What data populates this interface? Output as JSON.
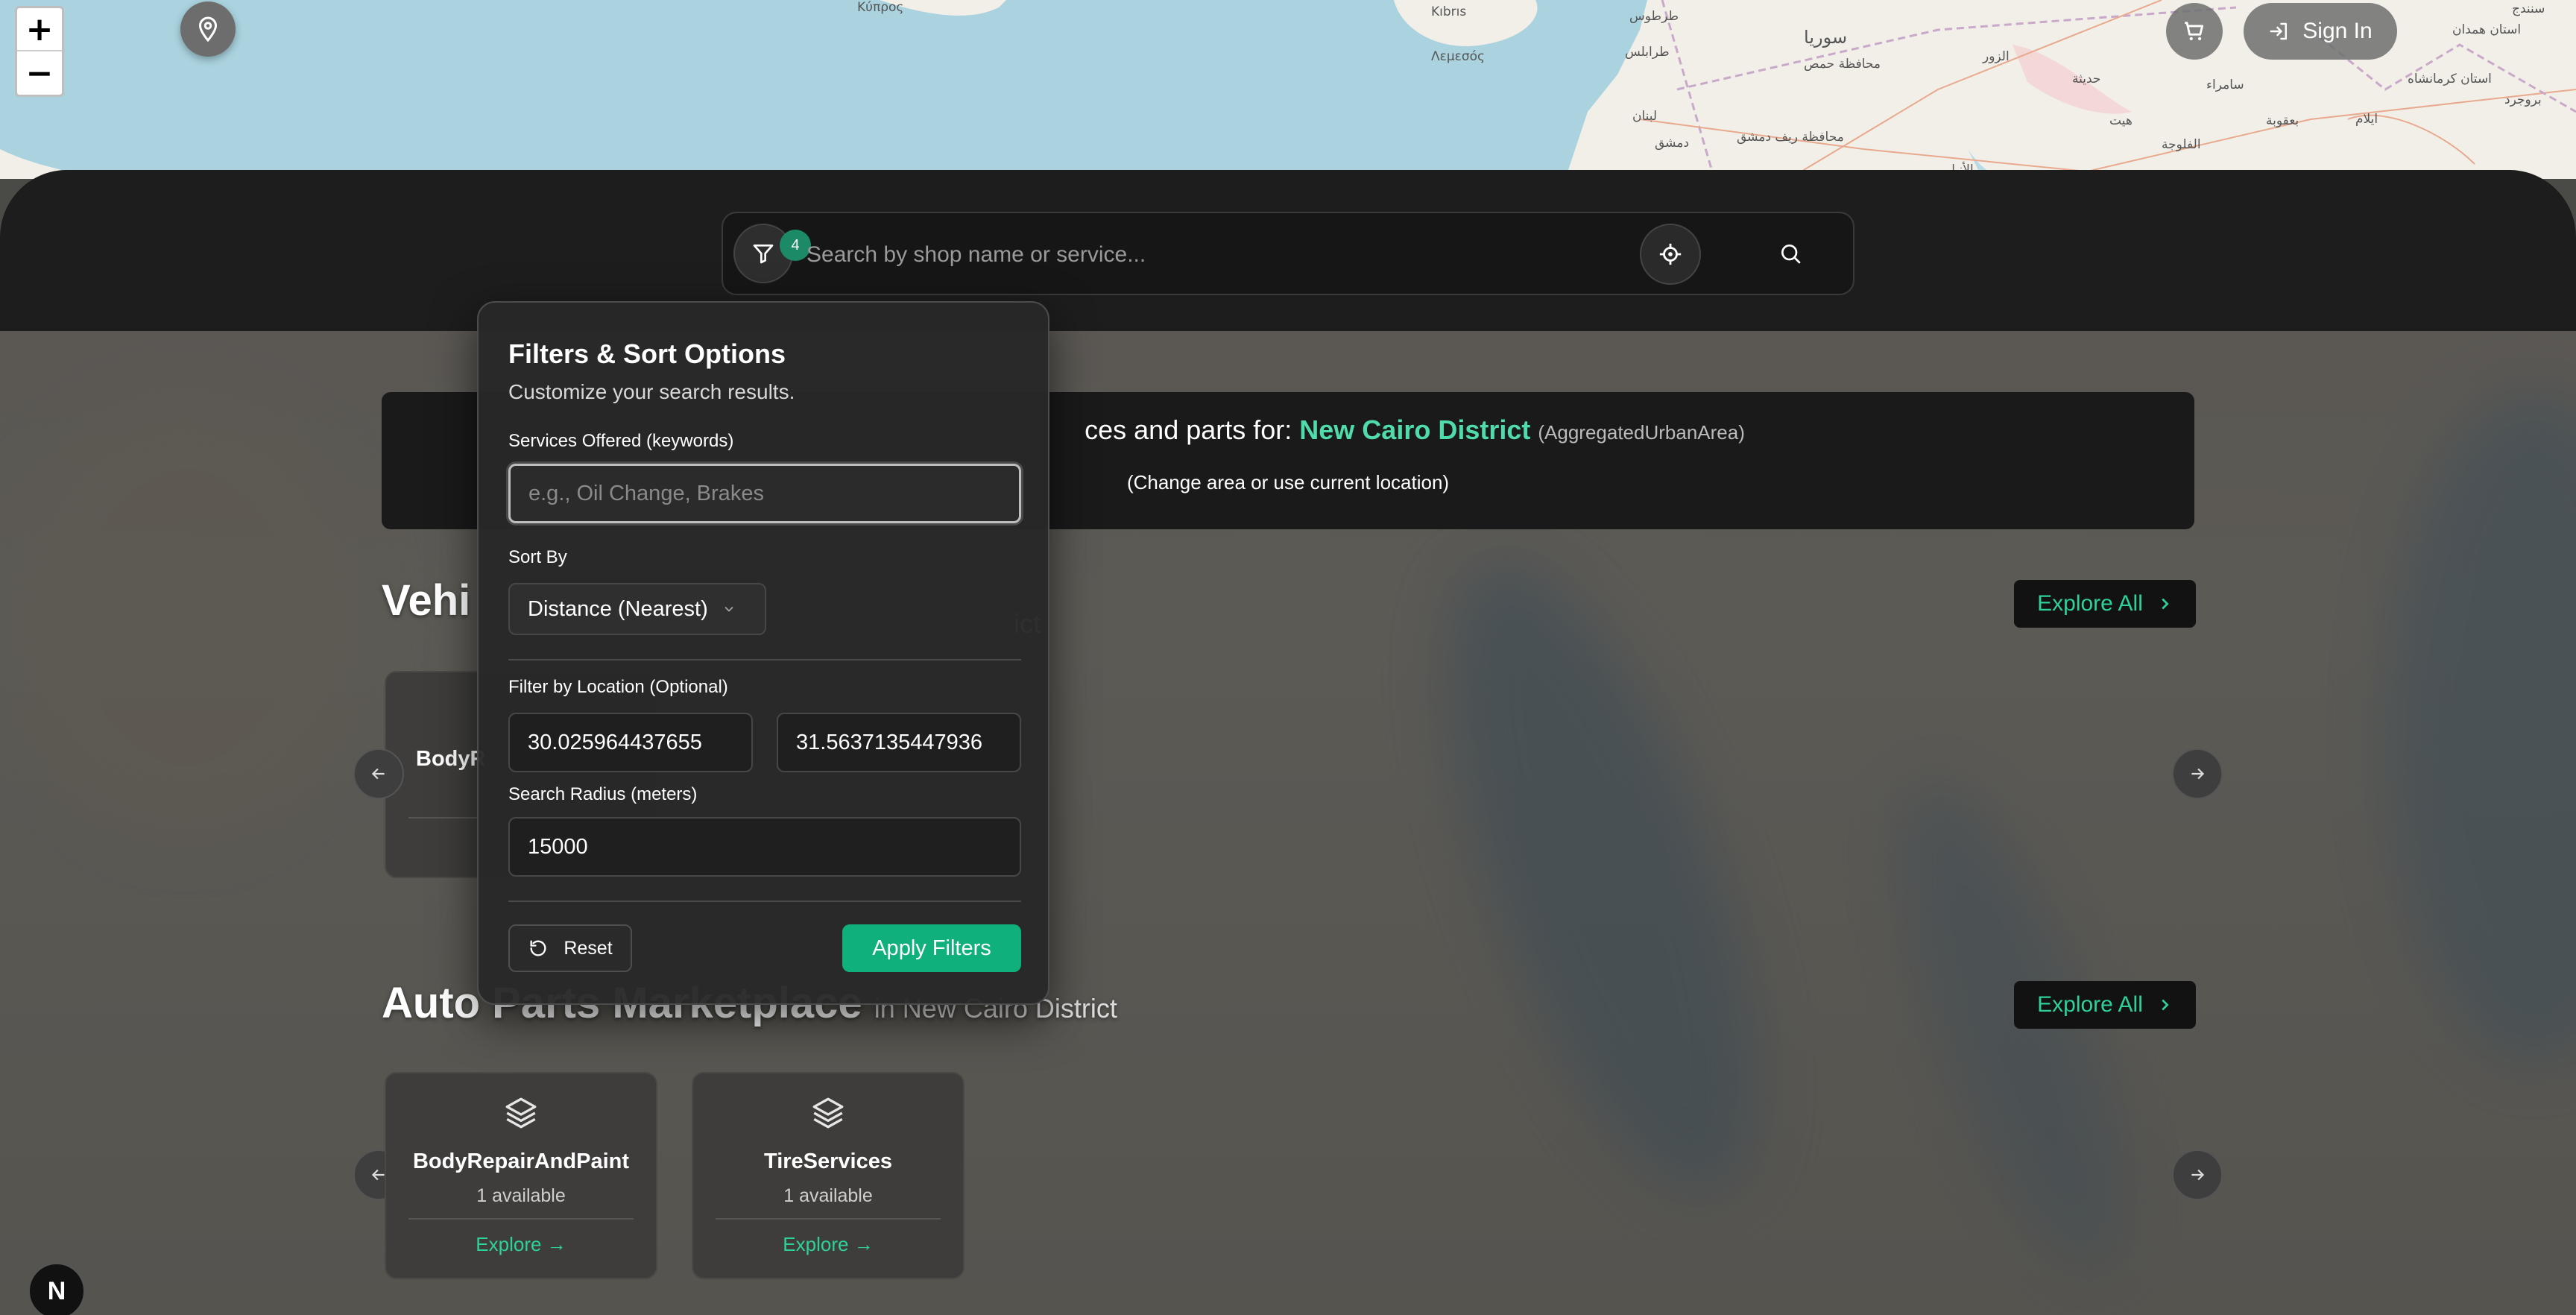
{
  "map": {
    "labels": {
      "kibris": "Kıbrıs",
      "lemesos": "Λεμεσός",
      "tartus": "طرطوس",
      "tripoli": "طرابلس",
      "syria": "سوريا",
      "homs": "محافظة حمص",
      "lebanon": "لبنان",
      "damascus": "دمشق",
      "rif": "محافظة ريف دمشق",
      "anbar": "الأنبار",
      "haditha": "حديثة",
      "samarra": "سامراء",
      "hit": "هيت",
      "falluja": "الفلوجة",
      "baquba": "بعقوبة",
      "zur": "الزور",
      "hamadan": "استان همدان",
      "kermanshah": "استان کرمانشاه",
      "ilam": "ایلام",
      "borujerd": "بروجرد",
      "sanandaj": "سنندج",
      "cyprus_top": "Κύπρος"
    }
  },
  "zoom": {
    "in": "+",
    "out": "−"
  },
  "header": {
    "signin_label": "Sign In"
  },
  "search": {
    "placeholder": "Search by shop name or service...",
    "filter_count": "4"
  },
  "area": {
    "prefix": "ces and parts for:",
    "name": "New Cairo District",
    "type": "(AggregatedUrbanArea)",
    "change": "(Change area or use current location)"
  },
  "sections": {
    "vehicle": {
      "title_visible": "Vehi",
      "sub_visible": "ict",
      "explore_all": "Explore All",
      "cards": [
        {
          "name_visible": "BodyR"
        }
      ]
    },
    "parts": {
      "title": "Auto Parts Marketplace",
      "sub": "in New Cairo District",
      "explore_all": "Explore All",
      "cards": [
        {
          "name": "BodyRepairAndPaint",
          "avail": "1 available",
          "explore": "Explore"
        },
        {
          "name": "TireServices",
          "avail": "1 available",
          "explore": "Explore"
        }
      ]
    }
  },
  "filters": {
    "title": "Filters & Sort Options",
    "subtitle": "Customize your search results.",
    "services_label": "Services Offered (keywords)",
    "services_placeholder": "e.g., Oil Change, Brakes",
    "sort_label": "Sort By",
    "sort_value": "Distance (Nearest)",
    "location_label": "Filter by Location (Optional)",
    "lat_value": "30.025964437655",
    "lng_value": "31.5637135447936",
    "radius_label": "Search Radius (meters)",
    "radius_value": "15000",
    "reset_label": "Reset",
    "apply_label": "Apply Filters"
  },
  "colors": {
    "accent": "#10b07c",
    "accent_text": "#2fd19a",
    "water": "#aad3df",
    "land": "#f2efe9"
  }
}
